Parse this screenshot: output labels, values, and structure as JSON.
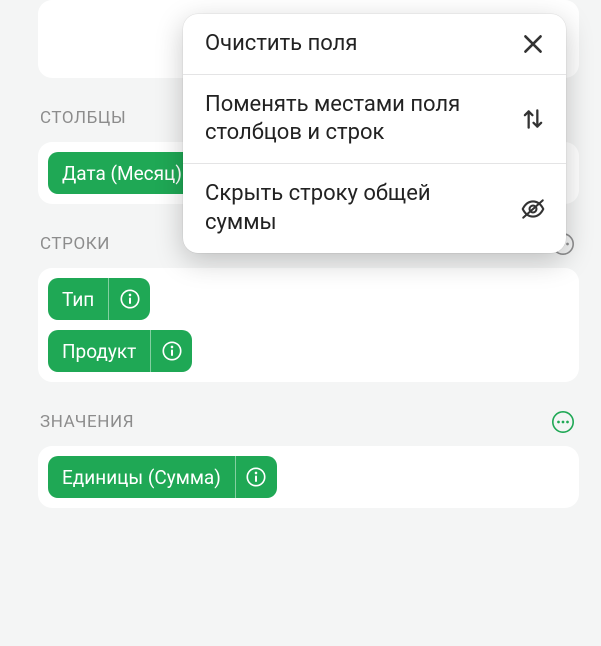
{
  "sections": {
    "columns": {
      "title": "СТОЛБЦЫ",
      "chips": [
        {
          "label": "Дата (Месяц)"
        }
      ]
    },
    "rows": {
      "title": "СТРОКИ",
      "chips": [
        {
          "label": "Тип"
        },
        {
          "label": "Продукт"
        }
      ]
    },
    "values": {
      "title": "ЗНАЧЕНИЯ",
      "chips": [
        {
          "label": "Единицы (Сумма)"
        }
      ]
    }
  },
  "menu": {
    "clear": "Очистить поля",
    "swap": "Поменять местами поля столбцов и строк",
    "hide_total": "Скрыть строку общей суммы"
  },
  "colors": {
    "chip": "#1fa855",
    "accent_outline": "#1fa855"
  }
}
